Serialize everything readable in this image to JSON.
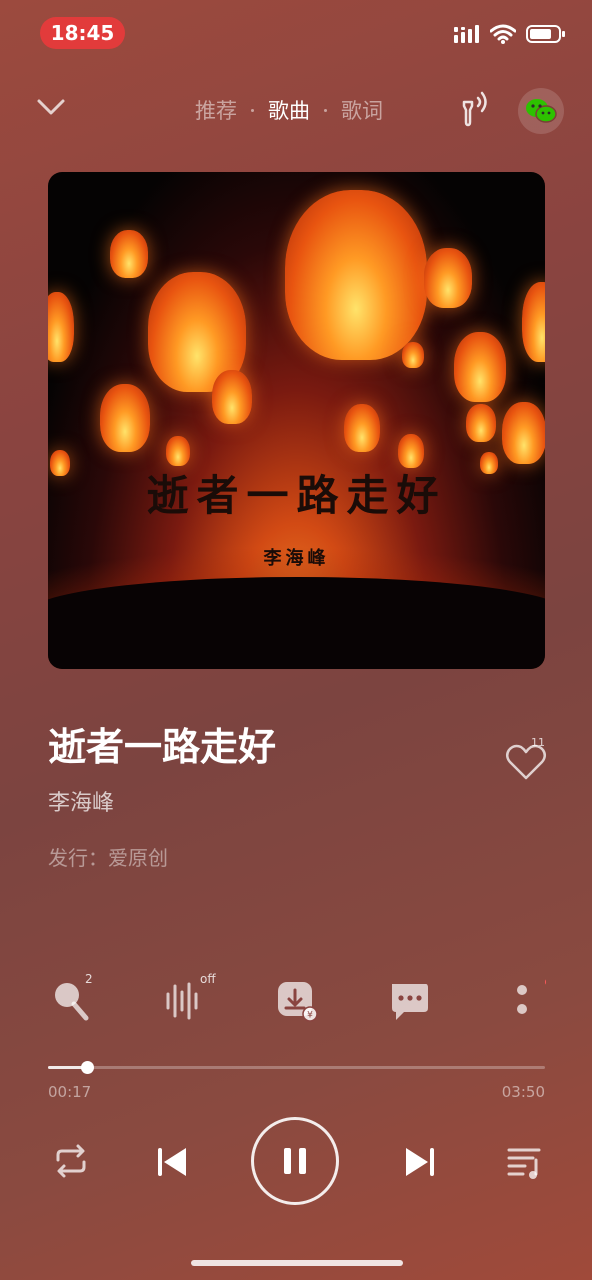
{
  "status_bar": {
    "time": "18:45"
  },
  "nav": {
    "tabs": [
      {
        "label": "推荐",
        "active": false
      },
      {
        "label": "歌曲",
        "active": true
      },
      {
        "label": "歌词",
        "active": false
      }
    ]
  },
  "album_art": {
    "title_text": "逝者一路走好",
    "artist_text": "李海峰"
  },
  "song": {
    "title": "逝者一路走好",
    "artist": "李海峰",
    "publisher": "发行：爱原创",
    "like_count": "11"
  },
  "actions": {
    "sing_badge": "2",
    "sound_effect_badge": "off"
  },
  "progress": {
    "current_time": "00:17",
    "total_time": "03:50",
    "fraction": 0.078
  },
  "colors": {
    "accent_red": "#e23b3b",
    "wechat_green": "#2dc100"
  }
}
